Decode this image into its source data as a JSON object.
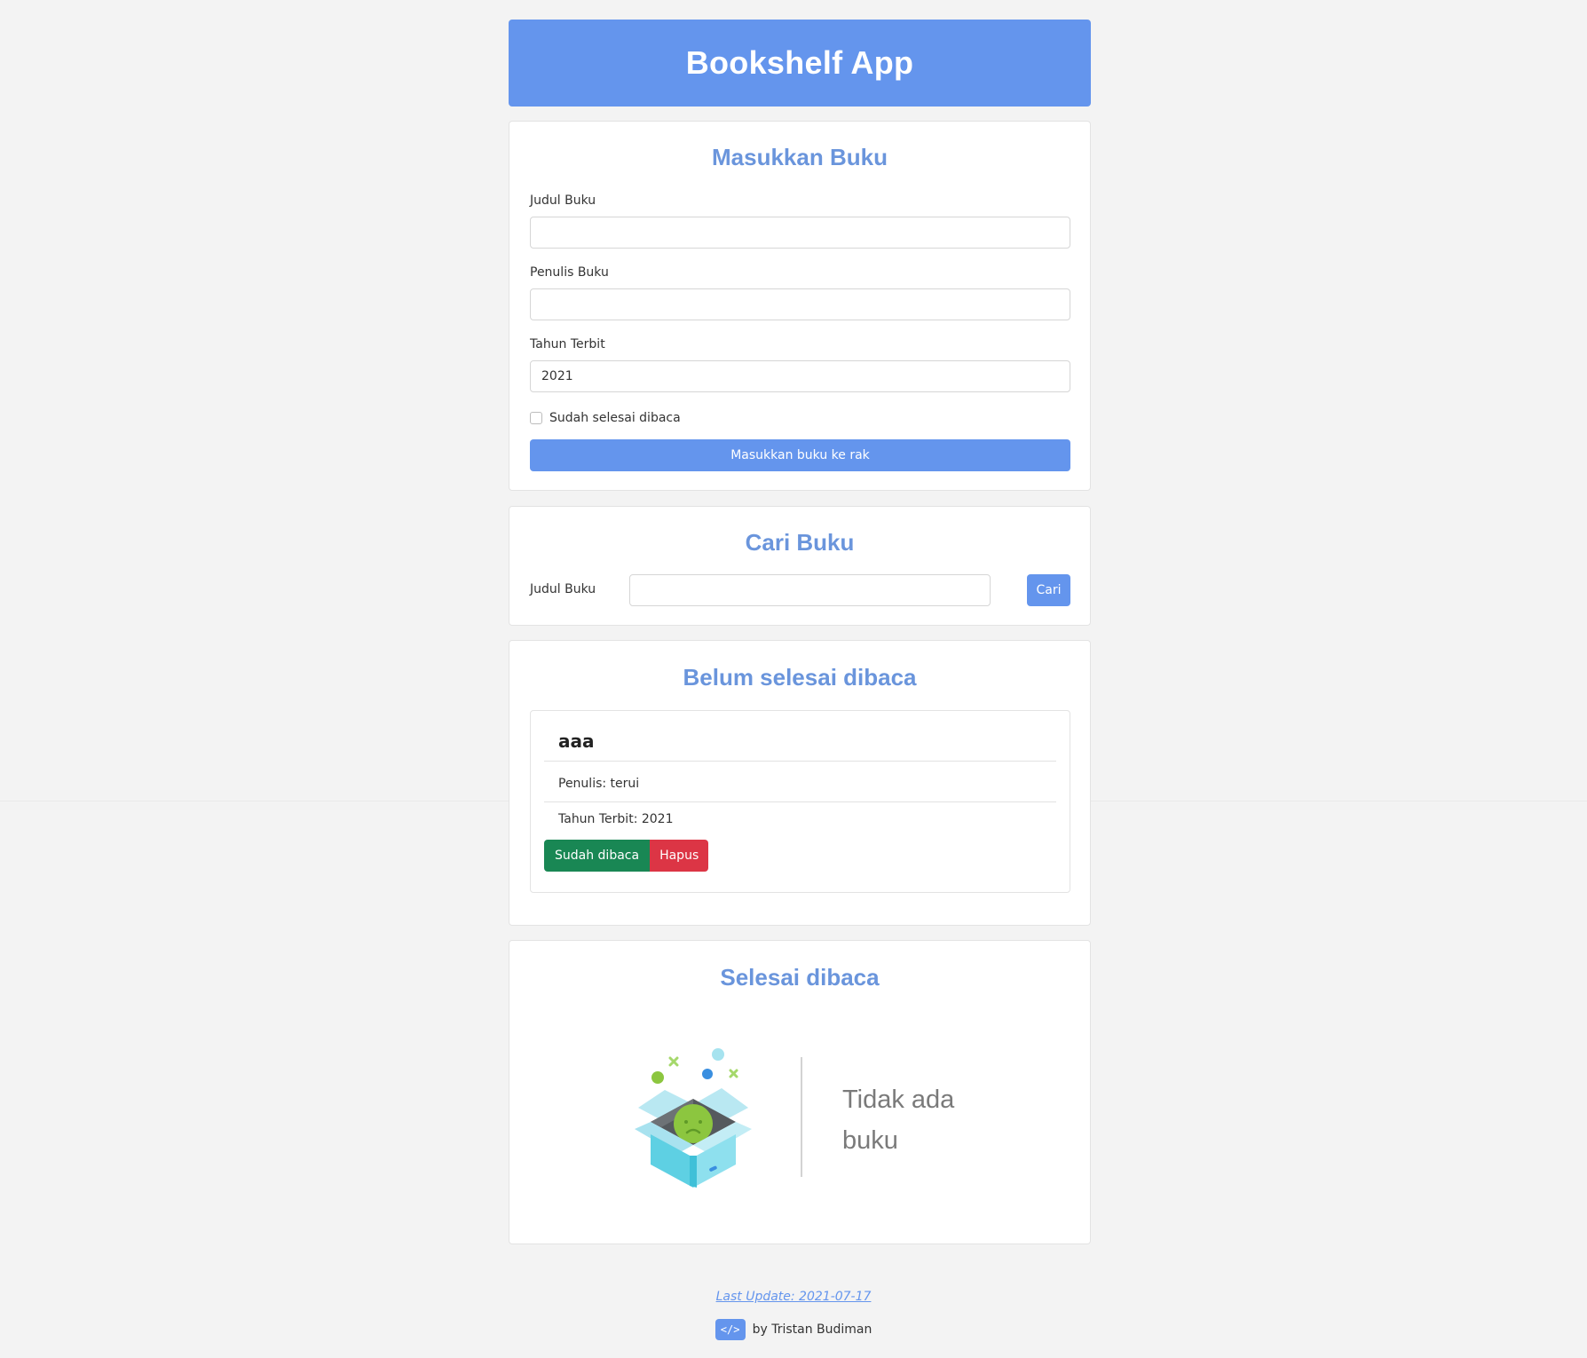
{
  "header": {
    "title": "Bookshelf App"
  },
  "input_section": {
    "heading": "Masukkan Buku",
    "title_label": "Judul Buku",
    "title_value": "",
    "author_label": "Penulis Buku",
    "author_value": "",
    "year_label": "Tahun Terbit",
    "year_value": "2021",
    "complete_label": "Sudah selesai dibaca",
    "complete_checked": false,
    "submit_label": "Masukkan buku ke rak"
  },
  "search_section": {
    "heading": "Cari Buku",
    "label": "Judul Buku",
    "value": "",
    "button_label": "Cari"
  },
  "incomplete_section": {
    "heading": "Belum selesai dibaca",
    "books": [
      {
        "title": "aaa",
        "author_text": "Penulis: terui",
        "year_text": "Tahun Terbit: 2021",
        "done_button": "Sudah dibaca",
        "delete_button": "Hapus"
      }
    ]
  },
  "complete_section": {
    "heading": "Selesai dibaca",
    "empty_text": "Tidak ada buku",
    "empty_icon": "empty-box-icon"
  },
  "footer": {
    "last_update": "Last Update: 2021-07-17",
    "code_icon_glyph": "</>",
    "byline": "by Tristan Budiman"
  },
  "colors": {
    "primary": "#6495ed",
    "heading": "#6a95dc",
    "success": "#198754",
    "danger": "#dc3545",
    "background": "#f3f3f3"
  }
}
